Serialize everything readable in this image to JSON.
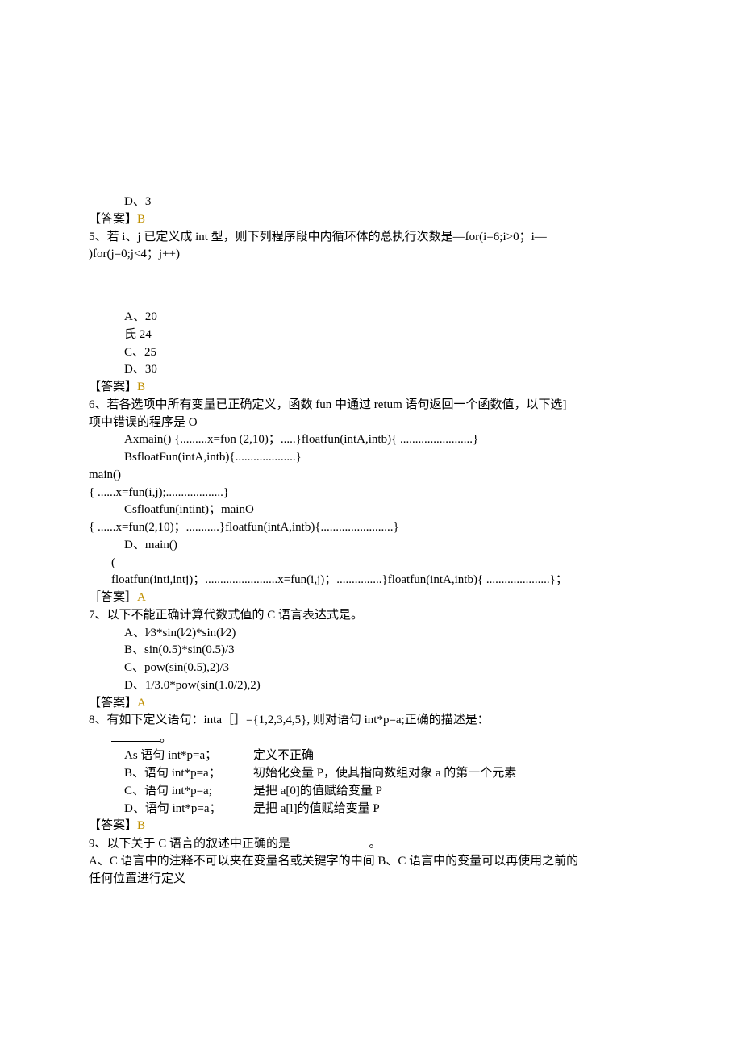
{
  "q4_optD": "D、3",
  "ans4_label": "【答案】",
  "ans4_letter": "B",
  "q5_stem_a": "5、若 i、j 已定义成 int 型，则下列程序段中内循环体的总执行次数是—for(i=6;i>0；i—",
  "q5_stem_b": ")for(j=0;j<4；j++)",
  "q5_A": "A、20",
  "q5_B": "氏 24",
  "q5_C": "C、25",
  "q5_D": "D、30",
  "ans5_label": "【答案】",
  "ans5_letter": "B",
  "q6_stem_a": "6、若各选项中所有变量已正确定义，函数 fun 中通过 retum 语句返回一个函数值，以下选]",
  "q6_stem_b": "项中错误的程序是 O",
  "q6_A": "Axmain()            {.........x=fυn   (2,10)；.....}floatfun(intA,intb){ ........................}",
  "q6_B": "BsfloatFun(intA,intb){....................}",
  "q6_main1": "main()",
  "q6_main1_body": "{ ......x=fun(i,j);...................}",
  "q6_C": "Csfloatfun(intint)；mainO",
  "q6_C_body": "{ ......x=fun(2,10)；...........}floatfun(intA,intb){........................}",
  "q6_D": "D、main()",
  "q6_open": "(",
  "q6_D_body": "floatfun(inti,intj)；........................x=fun(i,j)；...............}floatfun(intA,intb){ .....................}；",
  "ans6_label": "［答案］",
  "ans6_letter": "A",
  "q7_stem": "7、以下不能正确计算代数式值的 C 语言表达式是。",
  "q7_A": "A、l⁄3*sin(l⁄2)*sin(l⁄2)",
  "q7_B": "B、sin(0.5)*sin(0.5)/3",
  "q7_C": "C、pow(sin(0.5),2)/3",
  "q7_D": "D、1/3.0*pow(sin(1.0/2),2)",
  "ans7_label": "【答案】",
  "ans7_letter": "A",
  "q8_stem_a": "8、有如下定义语句：inta［］={1,2,3,4,5}, 则对语句 int*p=a;正确的描述是：",
  "q8_stem_b": "。",
  "q8_A_c1": "As 语句 int*p=a；",
  "q8_A_c2": "定义不正确",
  "q8_B_c1": "B、语句 int*p=a；",
  "q8_B_c2": "初始化变量 P，使其指向数组对象 a 的第一个元素",
  "q8_C_c1": "C、语句 int*p=a;",
  "q8_C_c2": "是把 a[0]的值赋给变量 P",
  "q8_D_c1": "D、语句 int*p=a；",
  "q8_D_c2": "是把 a[l]的值赋给变量 P",
  "ans8_label": "【答案】",
  "ans8_letter": "B",
  "q9_stem_a": "9、以下关于 C 语言的叙述中正确的是",
  "q9_stem_b": "。",
  "q9_line2": "A、C 语言中的注释不可以夹在变量名或关键字的中间 B、C 语言中的变量可以再使用之前的",
  "q9_line3": "任何位置进行定义"
}
